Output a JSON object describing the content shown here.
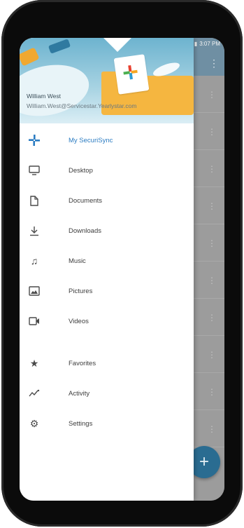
{
  "status_bar": {
    "time": "3:07 PM"
  },
  "user": {
    "name": "William West",
    "email": "William.West@Servicestar.Yearlystar.com"
  },
  "menu": [
    {
      "label": "My SecuriSync",
      "icon": "securisync-icon",
      "active": true
    },
    {
      "label": "Desktop",
      "icon": "desktop-icon"
    },
    {
      "label": "Documents",
      "icon": "document-icon"
    },
    {
      "label": "Downloads",
      "icon": "download-icon"
    },
    {
      "label": "Music",
      "icon": "music-icon"
    },
    {
      "label": "Pictures",
      "icon": "image-icon"
    },
    {
      "label": "Videos",
      "icon": "video-icon"
    },
    {
      "label": "Favorites",
      "icon": "star-icon"
    },
    {
      "label": "Activity",
      "icon": "activity-icon"
    },
    {
      "label": "Settings",
      "icon": "gear-icon"
    }
  ],
  "colors": {
    "accent": "#2b7cc2",
    "fab": "#2a6c91",
    "header": "#6db3cf",
    "folder": "#f5b640"
  },
  "fab": {
    "symbol": "+"
  }
}
